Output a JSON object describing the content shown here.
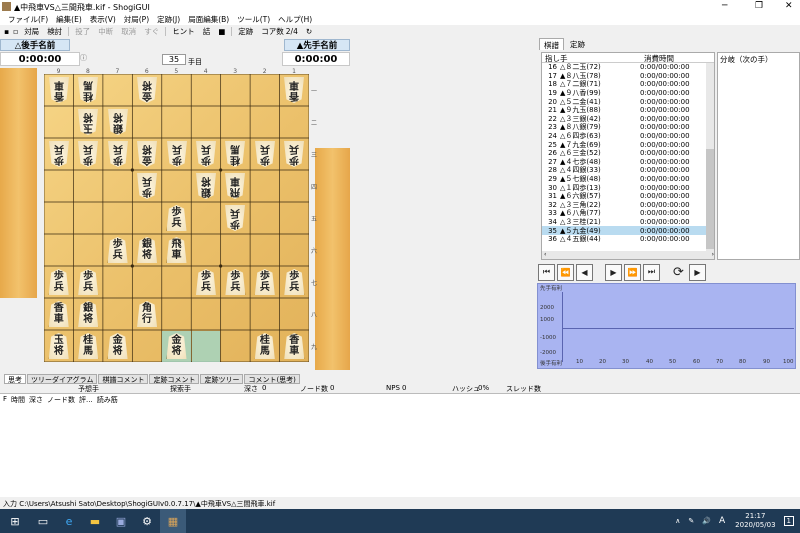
{
  "window": {
    "title": "▲中飛車VS△三間飛車.kif - ShogiGUI",
    "controls": [
      "─",
      "❐",
      "✕"
    ]
  },
  "menu": [
    "ファイル(F)",
    "編集(E)",
    "表示(V)",
    "対局(P)",
    "定跡(J)",
    "局面編集(B)",
    "ツール(T)",
    "ヘルプ(H)"
  ],
  "toolbar": {
    "items": [
      "対局",
      "検討",
      "投了",
      "中断",
      "取消",
      "すぐ",
      "ヒント",
      "詰",
      "定跡"
    ],
    "disabled": [
      false,
      false,
      true,
      true,
      true,
      true,
      false,
      false,
      false
    ],
    "move_number": "35",
    "move_suffix": "手目",
    "core_label": "コア数",
    "core_value": "2/4"
  },
  "players": {
    "gote_name": "△後手名前",
    "sente_name": "▲先手名前",
    "gote_time": "0:00:00",
    "sente_time": "0:00:00"
  },
  "board": {
    "files": [
      "9",
      "8",
      "7",
      "6",
      "5",
      "4",
      "3",
      "2",
      "1"
    ],
    "ranks": [
      "一",
      "二",
      "三",
      "四",
      "五",
      "六",
      "七",
      "八",
      "九"
    ],
    "gote_pieces": [
      {
        "label": "香車",
        "file": 9,
        "rank": 1
      },
      {
        "label": "桂馬",
        "file": 8,
        "rank": 1
      },
      {
        "label": "金将",
        "file": 6,
        "rank": 1
      },
      {
        "label": "香車",
        "file": 1,
        "rank": 1
      },
      {
        "label": "玉将",
        "file": 8,
        "rank": 2
      },
      {
        "label": "銀将",
        "file": 7,
        "rank": 2
      },
      {
        "label": "歩兵",
        "file": 9,
        "rank": 3
      },
      {
        "label": "歩兵",
        "file": 8,
        "rank": 3
      },
      {
        "label": "歩兵",
        "file": 7,
        "rank": 3
      },
      {
        "label": "金将",
        "file": 6,
        "rank": 3
      },
      {
        "label": "歩兵",
        "file": 5,
        "rank": 3
      },
      {
        "label": "歩兵",
        "file": 4,
        "rank": 3
      },
      {
        "label": "桂馬",
        "file": 3,
        "rank": 3
      },
      {
        "label": "歩兵",
        "file": 2,
        "rank": 3
      },
      {
        "label": "歩兵",
        "file": 1,
        "rank": 3
      },
      {
        "label": "歩兵",
        "file": 6,
        "rank": 4
      },
      {
        "label": "銀将",
        "file": 4,
        "rank": 4
      },
      {
        "label": "飛車",
        "file": 3,
        "rank": 4
      },
      {
        "label": "歩兵",
        "file": 3,
        "rank": 5
      }
    ],
    "sente_pieces": [
      {
        "label": "歩兵",
        "file": 5,
        "rank": 5
      },
      {
        "label": "歩兵",
        "file": 7,
        "rank": 6
      },
      {
        "label": "銀将",
        "file": 6,
        "rank": 6
      },
      {
        "label": "飛車",
        "file": 5,
        "rank": 6
      },
      {
        "label": "歩兵",
        "file": 9,
        "rank": 7
      },
      {
        "label": "歩兵",
        "file": 8,
        "rank": 7
      },
      {
        "label": "歩兵",
        "file": 4,
        "rank": 7
      },
      {
        "label": "歩兵",
        "file": 3,
        "rank": 7
      },
      {
        "label": "歩兵",
        "file": 2,
        "rank": 7
      },
      {
        "label": "歩兵",
        "file": 1,
        "rank": 7
      },
      {
        "label": "香車",
        "file": 9,
        "rank": 8
      },
      {
        "label": "銀将",
        "file": 8,
        "rank": 8
      },
      {
        "label": "角行",
        "file": 6,
        "rank": 8
      },
      {
        "label": "玉将",
        "file": 9,
        "rank": 9
      },
      {
        "label": "桂馬",
        "file": 8,
        "rank": 9
      },
      {
        "label": "金将",
        "file": 7,
        "rank": 9
      },
      {
        "label": "金将",
        "file": 5,
        "rank": 9
      },
      {
        "label": "桂馬",
        "file": 2,
        "rank": 9
      },
      {
        "label": "香車",
        "file": 1,
        "rank": 9
      }
    ],
    "highlighted": [
      {
        "file": 5,
        "rank": 9
      },
      {
        "file": 4,
        "rank": 9
      }
    ]
  },
  "right_tabs": [
    "棋譜",
    "定跡"
  ],
  "kifu": {
    "head_move": "指し手",
    "head_time": "消費時間",
    "branch_head": "分岐（次の手）",
    "rows": [
      {
        "n": "16",
        "move": "△８二玉(72)",
        "time": "0:00/00:00:00"
      },
      {
        "n": "17",
        "move": "▲８八玉(78)",
        "time": "0:00/00:00:00"
      },
      {
        "n": "18",
        "move": "△７二銀(71)",
        "time": "0:00/00:00:00"
      },
      {
        "n": "19",
        "move": "▲９八香(99)",
        "time": "0:00/00:00:00"
      },
      {
        "n": "20",
        "move": "△５二金(41)",
        "time": "0:00/00:00:00"
      },
      {
        "n": "21",
        "move": "▲９九玉(88)",
        "time": "0:00/00:00:00"
      },
      {
        "n": "22",
        "move": "△３三銀(42)",
        "time": "0:00/00:00:00"
      },
      {
        "n": "23",
        "move": "▲８八銀(79)",
        "time": "0:00/00:00:00"
      },
      {
        "n": "24",
        "move": "△６四歩(63)",
        "time": "0:00/00:00:00"
      },
      {
        "n": "25",
        "move": "▲７九金(69)",
        "time": "0:00/00:00:00"
      },
      {
        "n": "26",
        "move": "△６三金(52)",
        "time": "0:00/00:00:00"
      },
      {
        "n": "27",
        "move": "▲４七歩(48)",
        "time": "0:00/00:00:00"
      },
      {
        "n": "28",
        "move": "△４四銀(33)",
        "time": "0:00/00:00:00"
      },
      {
        "n": "29",
        "move": "▲５七銀(48)",
        "time": "0:00/00:00:00"
      },
      {
        "n": "30",
        "move": "△１四歩(13)",
        "time": "0:00/00:00:00"
      },
      {
        "n": "31",
        "move": "▲６六銀(57)",
        "time": "0:00/00:00:00"
      },
      {
        "n": "32",
        "move": "△３三角(22)",
        "time": "0:00/00:00:00"
      },
      {
        "n": "33",
        "move": "▲６八角(77)",
        "time": "0:00/00:00:00"
      },
      {
        "n": "34",
        "move": "△３三桂(21)",
        "time": "0:00/00:00:00"
      },
      {
        "n": "35",
        "move": "▲５九金(49)",
        "time": "0:00/00:00:00"
      },
      {
        "n": "36",
        "move": "△４五銀(44)",
        "time": "0:00/00:00:00"
      }
    ],
    "selected_index": 19
  },
  "graph": {
    "top_label": "先手有利",
    "bottom_label": "後手有利",
    "y_ticks": [
      "2000",
      "1000",
      "-1000",
      "-2000"
    ],
    "x_ticks": [
      "10",
      "20",
      "30",
      "40",
      "50",
      "60",
      "70",
      "80",
      "90",
      "100"
    ]
  },
  "bottom_tabs": [
    "思考",
    "ツリーダイアグラム",
    "棋譜コメント",
    "定跡コメント",
    "定跡ツリー",
    "コメント(思考)"
  ],
  "info": {
    "pred_label": "予想手",
    "search_label": "探索手",
    "depth_label": "深さ",
    "depth": "0",
    "nodes_label": "ノード数",
    "nodes": "0",
    "nps_label": "NPS",
    "nps": "0",
    "hash_label": "ハッシュ",
    "hash": "0%",
    "threads_label": "スレッド数",
    "threads": "-"
  },
  "think_head": [
    "F",
    "時間",
    "深さ",
    "ノード数",
    "評...",
    "読み筋"
  ],
  "status": "入力  C:\\Users\\Atsushi Sato\\Desktop\\ShogiGUIv0.0.7.17\\▲中飛車VS△三間飛車.kif",
  "taskbar": {
    "time": "21:17",
    "date": "2020/05/03",
    "ime": "A",
    "notif": "1"
  }
}
